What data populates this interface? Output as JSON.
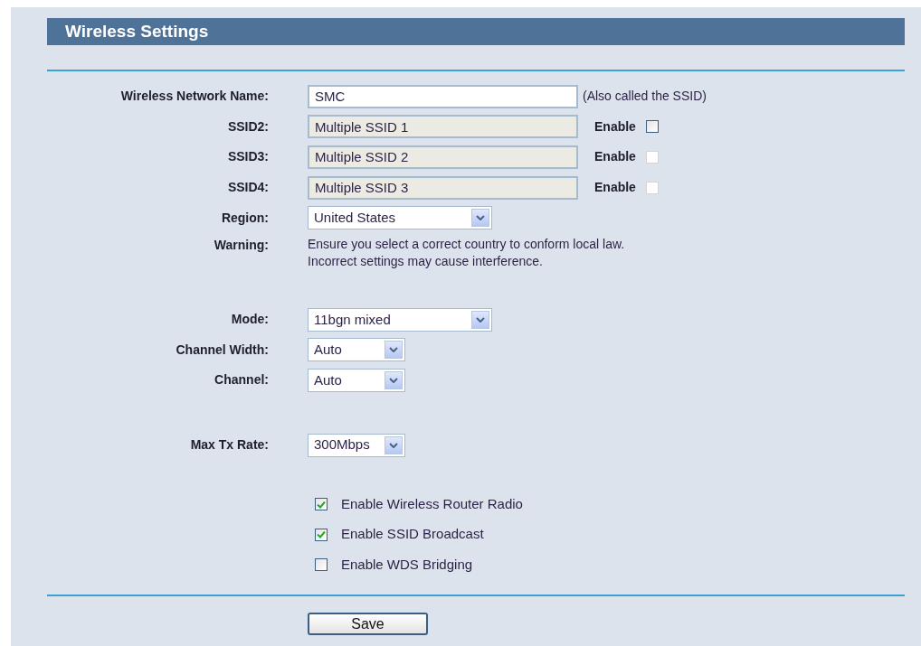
{
  "title": "Wireless Settings",
  "groups": [
    [
      {
        "kind": "text",
        "label": "Wireless Network Name:",
        "value": "SMC",
        "disabled": false,
        "note": "(Also called the SSID)"
      },
      {
        "kind": "text",
        "label": "SSID2:",
        "value": "Multiple SSID 1",
        "disabled": true,
        "enable": {
          "label": "Enable",
          "checked": false,
          "disabled": false
        }
      },
      {
        "kind": "text",
        "label": "SSID3:",
        "value": "Multiple SSID 2",
        "disabled": true,
        "enable": {
          "label": "Enable",
          "checked": false,
          "disabled": true
        }
      },
      {
        "kind": "text",
        "label": "SSID4:",
        "value": "Multiple SSID 3",
        "disabled": true,
        "enable": {
          "label": "Enable",
          "checked": false,
          "disabled": true
        }
      },
      {
        "kind": "select-wide",
        "label": "Region:",
        "value": "United States"
      },
      {
        "kind": "warning",
        "label": "Warning:",
        "lines": [
          "Ensure you select a correct country to conform local law.",
          "Incorrect settings may cause interference."
        ]
      }
    ],
    [
      {
        "kind": "select-wide",
        "label": "Mode:",
        "value": "11bgn mixed"
      },
      {
        "kind": "select",
        "label": "Channel Width:",
        "value": "Auto"
      },
      {
        "kind": "select",
        "label": "Channel:",
        "value": "Auto"
      }
    ],
    [
      {
        "kind": "select",
        "label": "Max Tx Rate:",
        "value": "300Mbps"
      }
    ]
  ],
  "options": [
    {
      "label": "Enable Wireless Router Radio",
      "checked": true
    },
    {
      "label": "Enable SSID Broadcast",
      "checked": true
    },
    {
      "label": "Enable WDS Bridging",
      "checked": false
    }
  ],
  "save_button": "Save"
}
